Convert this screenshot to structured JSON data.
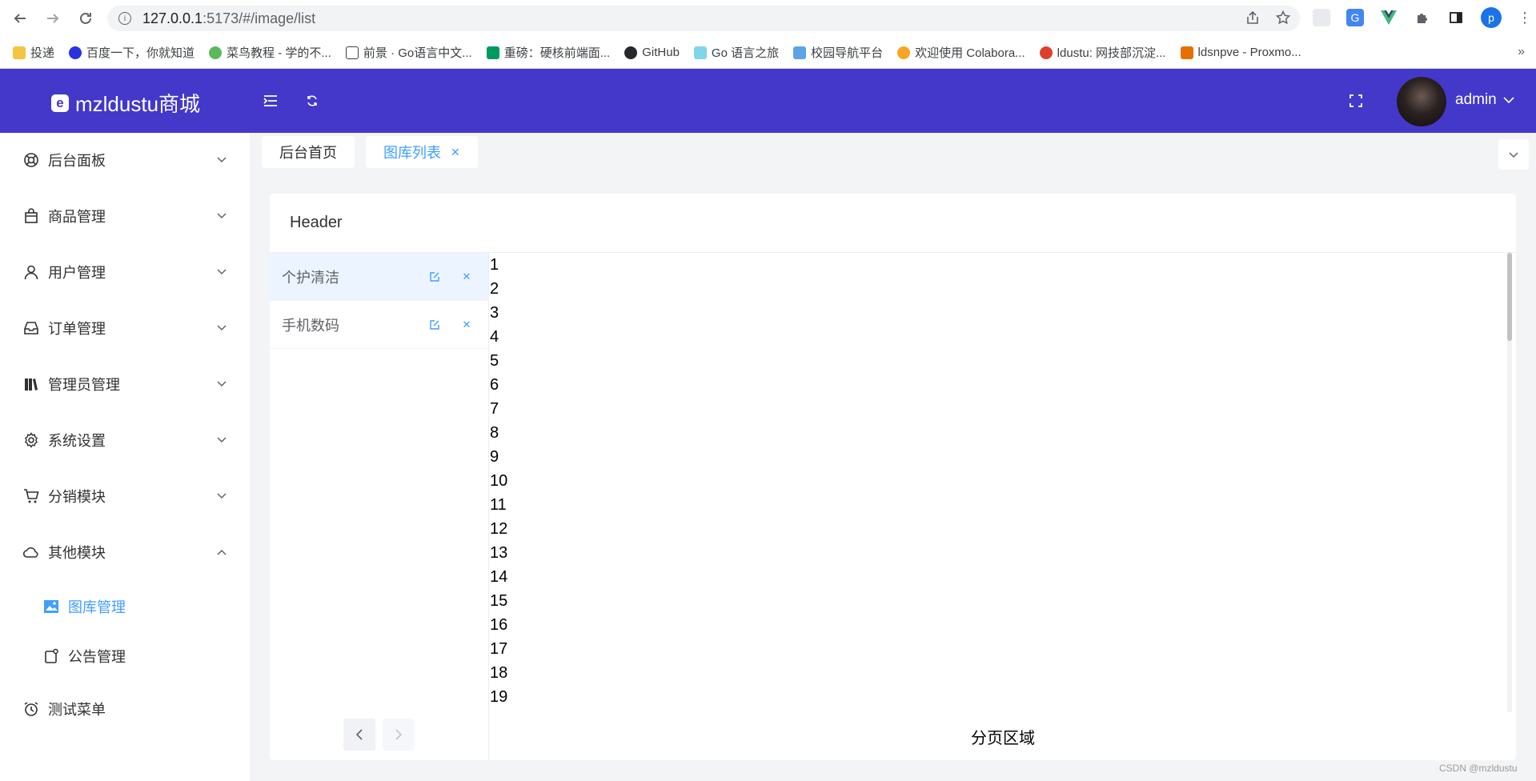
{
  "browser": {
    "url_host": "127.0.0.1",
    "url_path": ":5173/#/image/list",
    "bookmarks": [
      "投递",
      "百度一下，你就知道",
      "菜鸟教程 - 学的不...",
      "前景 · Go语言中文...",
      "重磅：硬核前端面...",
      "GitHub",
      "Go 语言之旅",
      "校园导航平台",
      "欢迎使用 Colabora...",
      "ldustu: 网技部沉淀...",
      "ldsnpve - Proxmo..."
    ],
    "profile_initial": "p"
  },
  "header": {
    "logo_text": "mzldustu商城",
    "username": "admin"
  },
  "sidebar": {
    "items": [
      {
        "label": "后台面板"
      },
      {
        "label": "商品管理"
      },
      {
        "label": "用户管理"
      },
      {
        "label": "订单管理"
      },
      {
        "label": "管理员管理"
      },
      {
        "label": "系统设置"
      },
      {
        "label": "分销模块"
      },
      {
        "label": "其他模块"
      },
      {
        "label": "测试菜单"
      }
    ],
    "sub_items": [
      {
        "label": "图库管理"
      },
      {
        "label": "公告管理"
      }
    ]
  },
  "tabs": [
    {
      "label": "后台首页"
    },
    {
      "label": "图库列表"
    }
  ],
  "card": {
    "header_title": "Header",
    "categories": [
      {
        "label": "个护清洁"
      },
      {
        "label": "手机数码"
      }
    ],
    "numbers": [
      "1",
      "2",
      "3",
      "4",
      "5",
      "6",
      "7",
      "8",
      "9",
      "10",
      "11",
      "12",
      "13",
      "14",
      "15",
      "16",
      "17",
      "18",
      "19"
    ],
    "pagination_area_label": "分页区域"
  },
  "watermark": "CSDN @mzldustu",
  "colors": {
    "header_bg": "#4338ca",
    "accent": "#409eff"
  }
}
